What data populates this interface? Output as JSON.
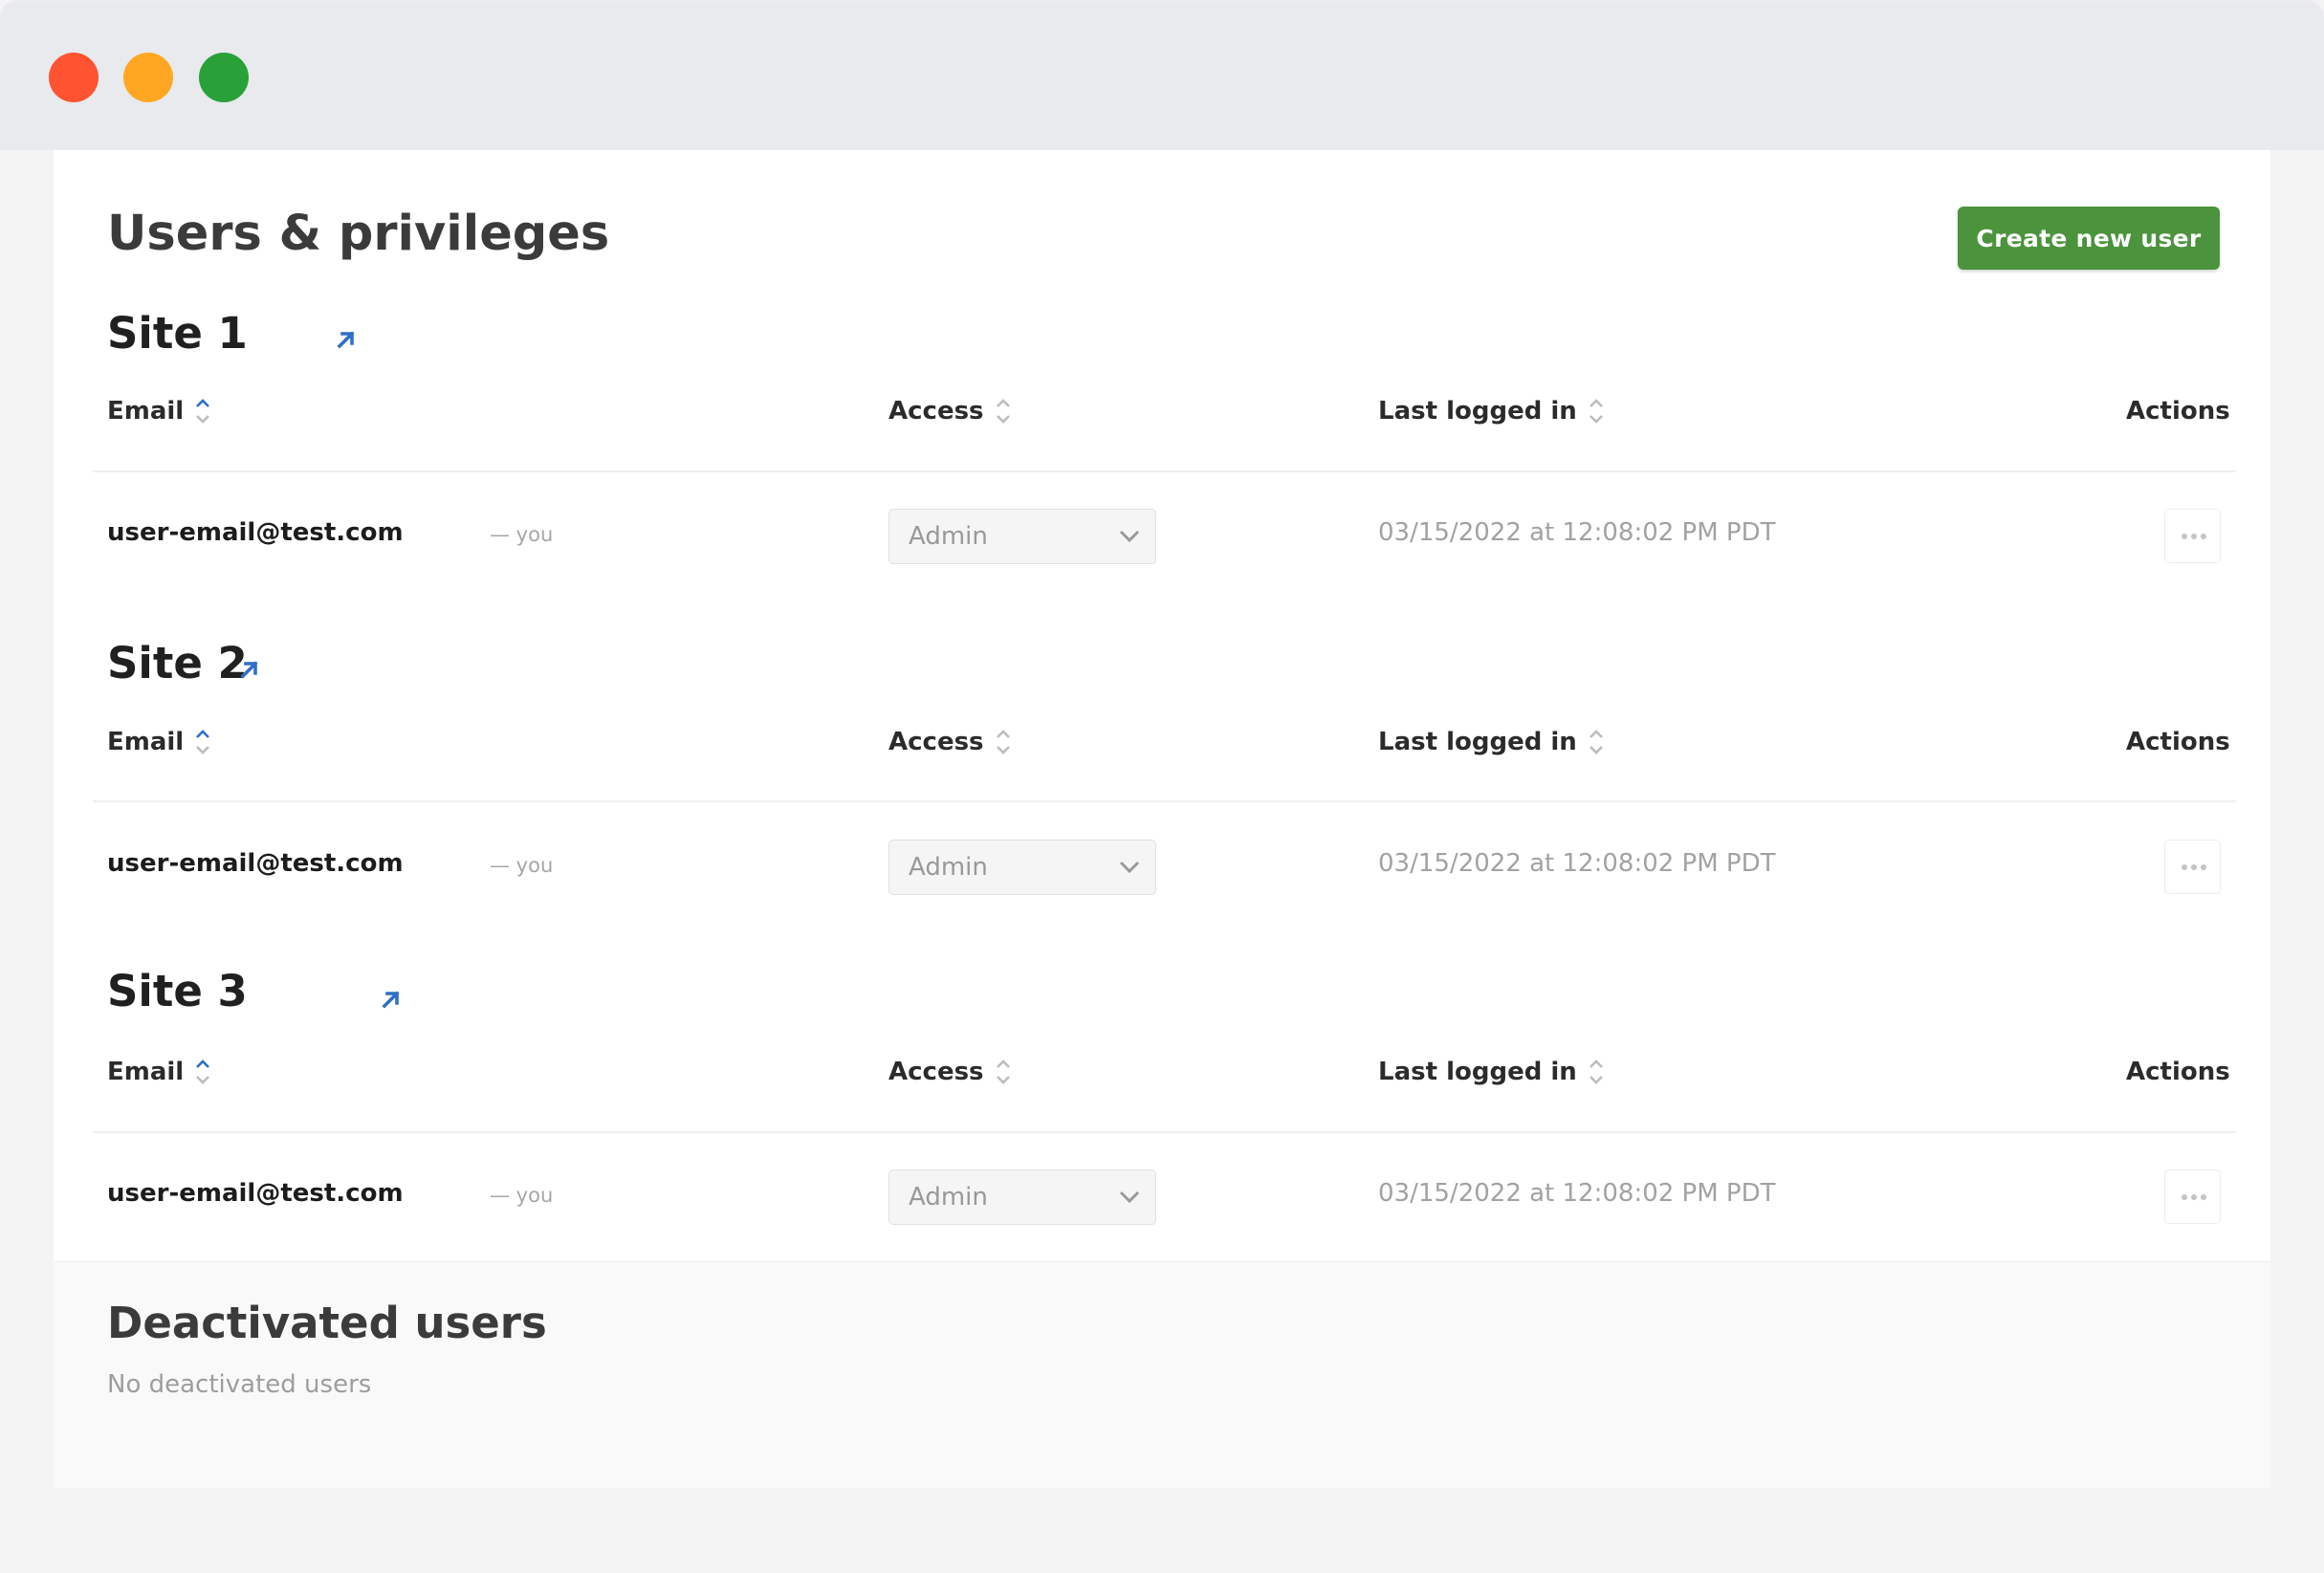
{
  "window": {
    "controls": [
      "close",
      "minimize",
      "maximize"
    ],
    "colors": {
      "close": "#ff5331",
      "minimize": "#ffa722",
      "maximize": "#29a138"
    }
  },
  "page": {
    "title": "Users & privileges",
    "create_button_label": "Create new user",
    "accent_color": "#4b933c",
    "link_color": "#2f6fc7"
  },
  "columns": {
    "email": "Email",
    "access": "Access",
    "last_logged_in": "Last logged in",
    "actions": "Actions"
  },
  "sites": [
    {
      "name": "Site 1",
      "external_link_icon": "external-link-icon",
      "users": [
        {
          "email": "user-email@test.com",
          "self_tag": "— you",
          "access": "Admin",
          "last_logged_in": "03/15/2022 at 12:08:02 PM PDT",
          "actions_icon": "more-horizontal-icon"
        }
      ]
    },
    {
      "name": "Site 2",
      "external_link_icon": "external-link-icon",
      "users": [
        {
          "email": "user-email@test.com",
          "self_tag": "— you",
          "access": "Admin",
          "last_logged_in": "03/15/2022 at 12:08:02 PM PDT",
          "actions_icon": "more-horizontal-icon"
        }
      ]
    },
    {
      "name": "Site 3",
      "external_link_icon": "external-link-icon",
      "users": [
        {
          "email": "user-email@test.com",
          "self_tag": "— you",
          "access": "Admin",
          "last_logged_in": "03/15/2022 at 12:08:02 PM PDT",
          "actions_icon": "more-horizontal-icon"
        }
      ]
    }
  ],
  "deactivated": {
    "title": "Deactivated users",
    "empty_message": "No deactivated users"
  }
}
